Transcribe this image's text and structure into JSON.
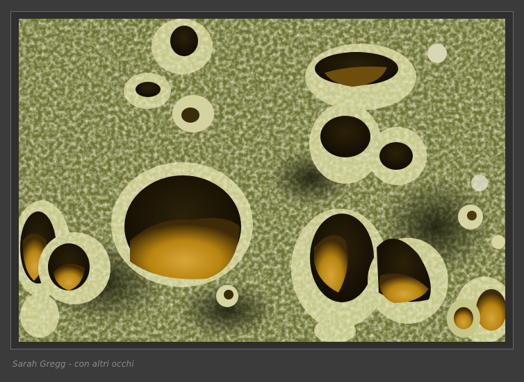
{
  "caption": "Sarah Gregg - con altri occhi",
  "photo_subject": "lichen-apothecia",
  "colors": {
    "background": "#3b3b3b",
    "mat": "#2f2f2f",
    "border": "#6a6a6a",
    "caption": "#8a8a8a",
    "lichen": "#a9ad6a",
    "cup_interior": "#b88a12"
  }
}
